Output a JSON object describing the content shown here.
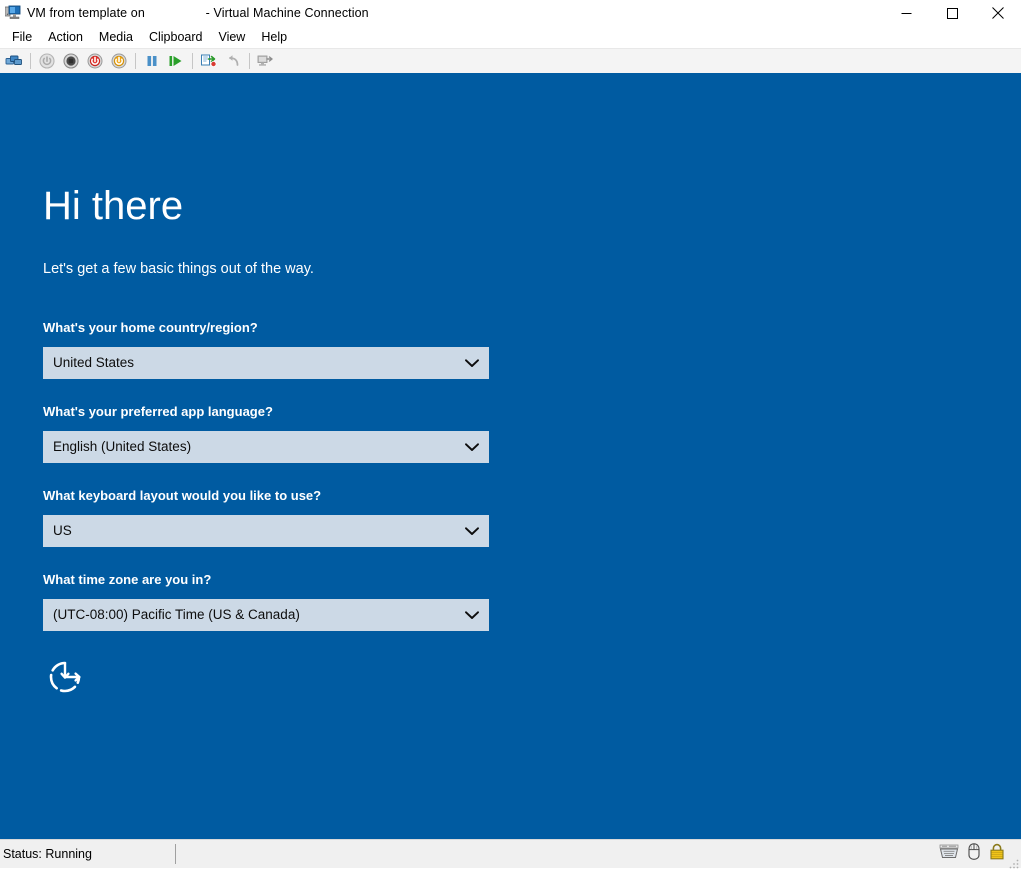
{
  "window": {
    "title": "VM from template on                 - Virtual Machine Connection",
    "app_icon": "virtual-machine-icon",
    "controls": {
      "minimize": "minimize-icon",
      "maximize": "maximize-icon",
      "close": "close-icon"
    }
  },
  "menu": {
    "items": [
      {
        "label": "File"
      },
      {
        "label": "Action"
      },
      {
        "label": "Media"
      },
      {
        "label": "Clipboard"
      },
      {
        "label": "View"
      },
      {
        "label": "Help"
      }
    ]
  },
  "toolbar": {
    "buttons": [
      {
        "name": "ctrl-alt-delete-icon",
        "disabled": false
      },
      {
        "name": "separator"
      },
      {
        "name": "start-icon",
        "disabled": true
      },
      {
        "name": "turn-off-icon",
        "disabled": false
      },
      {
        "name": "shut-down-icon",
        "disabled": false
      },
      {
        "name": "save-icon",
        "disabled": false
      },
      {
        "name": "separator"
      },
      {
        "name": "pause-icon",
        "disabled": false
      },
      {
        "name": "reset-icon",
        "disabled": false
      },
      {
        "name": "separator"
      },
      {
        "name": "checkpoint-icon",
        "disabled": false
      },
      {
        "name": "revert-icon",
        "disabled": true
      },
      {
        "name": "separator"
      },
      {
        "name": "enhanced-session-icon",
        "disabled": true
      }
    ]
  },
  "oobe": {
    "heading": "Hi there",
    "subheading": "Let's get a few basic things out of the way.",
    "next_icon": "next-arrow-icon",
    "fields": [
      {
        "label": "What's your home country/region?",
        "value": "United States",
        "name": "home-country-region"
      },
      {
        "label": "What's your preferred app language?",
        "value": "English (United States)",
        "name": "preferred-app-language"
      },
      {
        "label": "What keyboard layout would you like to use?",
        "value": "US",
        "name": "keyboard-layout"
      },
      {
        "label": "What time zone are you in?",
        "value": "(UTC-08:00) Pacific Time (US & Canada)",
        "name": "time-zone"
      }
    ]
  },
  "status_bar": {
    "text": "Status: Running",
    "icons": [
      {
        "name": "keyboard-capture-icon"
      },
      {
        "name": "mouse-capture-icon"
      },
      {
        "name": "lock-icon"
      }
    ]
  },
  "colors": {
    "vm_background": "#005ba1",
    "combo_background": "#ccd9e6",
    "window_chrome": "#f0f0f0",
    "text_on_blue": "#ffffff"
  }
}
